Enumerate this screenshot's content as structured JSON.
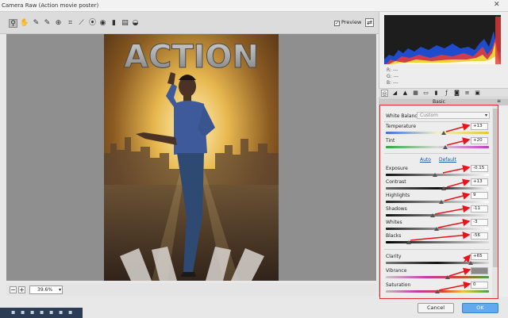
{
  "window": {
    "title": "Camera Raw (Action movie poster)",
    "close_glyph": "✕"
  },
  "toolbar": {
    "tools": [
      "zoom-icon",
      "hand-icon",
      "eyedropper-icon",
      "color-sampler-icon",
      "targeted-adjustment-icon",
      "crop-icon",
      "straighten-icon",
      "spot-removal-icon",
      "red-eye-icon",
      "adjustment-brush-icon",
      "graduated-filter-icon",
      "rotate-icon"
    ],
    "preview_label": "Preview",
    "preview_checked": true
  },
  "photo": {
    "headline": "ACTION"
  },
  "zoom": {
    "value": "39.6%",
    "minus": "−",
    "plus": "+"
  },
  "histogram": {
    "r_label": "R:",
    "g_label": "G:",
    "b_label": "B:",
    "r_value": "---",
    "g_value": "---",
    "b_value": "---"
  },
  "panel": {
    "section_title": "Basic",
    "white_balance_label": "White Balance:",
    "white_balance_value": "Custom",
    "auto_link": "Auto",
    "default_link": "Default",
    "sliders": [
      {
        "label": "Temperature",
        "value": "+13",
        "position": 0.56
      },
      {
        "label": "Tint",
        "value": "+20",
        "position": 0.58
      },
      {
        "label": "Exposure",
        "value": "-0.15",
        "position": 0.48
      },
      {
        "label": "Contrast",
        "value": "+13",
        "position": 0.56
      },
      {
        "label": "Highlights",
        "value": "9",
        "position": 0.54
      },
      {
        "label": "Shadows",
        "value": "-11",
        "position": 0.45
      },
      {
        "label": "Whites",
        "value": "-3",
        "position": 0.49
      },
      {
        "label": "Blacks",
        "value": "-56",
        "position": 0.22
      },
      {
        "label": "Clarity",
        "value": "+65",
        "position": 0.82
      },
      {
        "label": "Vibrance",
        "value": "",
        "position": 0.6
      },
      {
        "label": "Saturation",
        "value": "0",
        "position": 0.5
      }
    ]
  },
  "buttons": {
    "cancel": "Cancel",
    "ok": "OK"
  },
  "colors": {
    "highlight_box": "#e52b2b",
    "ok_button": "#63a9ee",
    "annotation_arrow": "#e8141b"
  }
}
